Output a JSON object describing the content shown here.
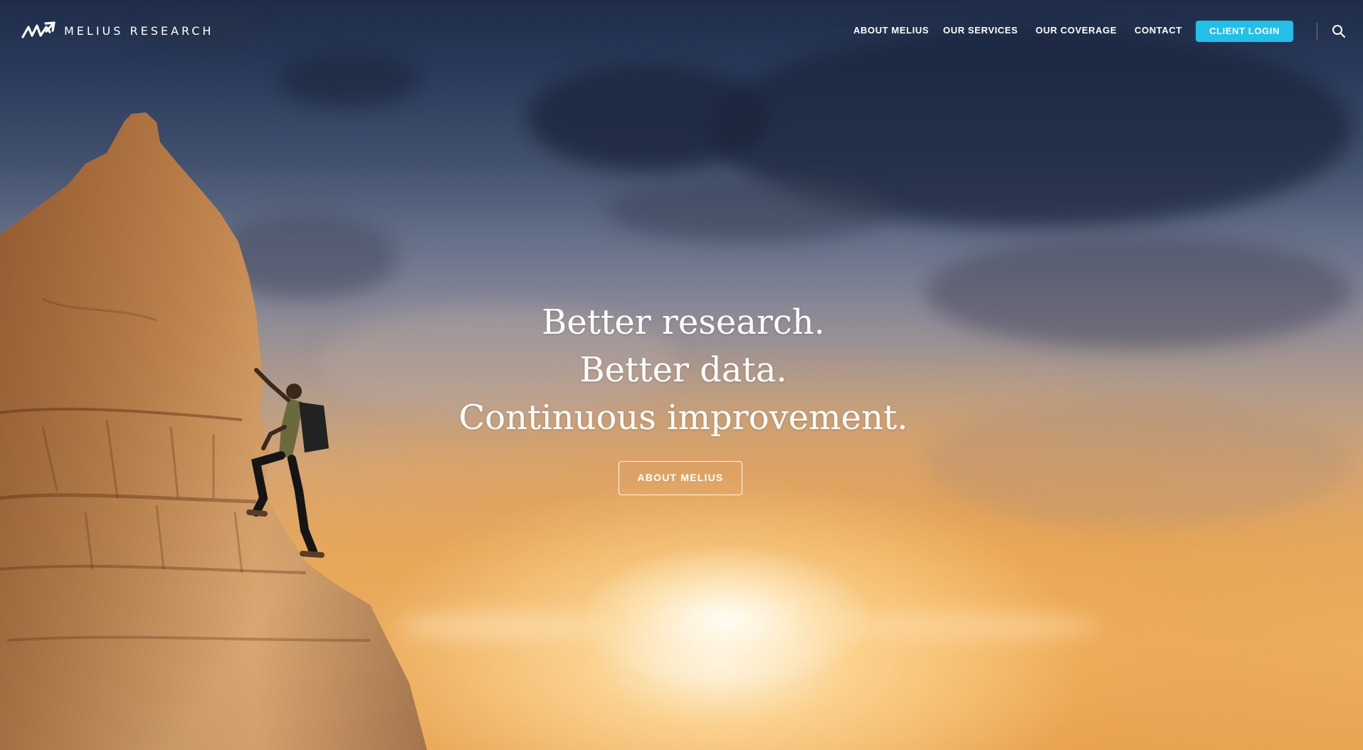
{
  "brand": {
    "name": "MELIUS RESEARCH",
    "logo_icon": "melius-m-arrow-logo"
  },
  "nav": {
    "items": [
      {
        "label": "ABOUT MELIUS"
      },
      {
        "label": "OUR SERVICES"
      },
      {
        "label": "OUR COVERAGE"
      },
      {
        "label": "CONTACT"
      }
    ],
    "login_label": "CLIENT LOGIN",
    "search_icon": "search-icon"
  },
  "hero": {
    "lines": [
      "Better research.",
      "Better data.",
      "Continuous improvement."
    ],
    "cta_label": "ABOUT MELIUS"
  },
  "colors": {
    "accent": "#22bfe9",
    "text": "#ffffff"
  }
}
